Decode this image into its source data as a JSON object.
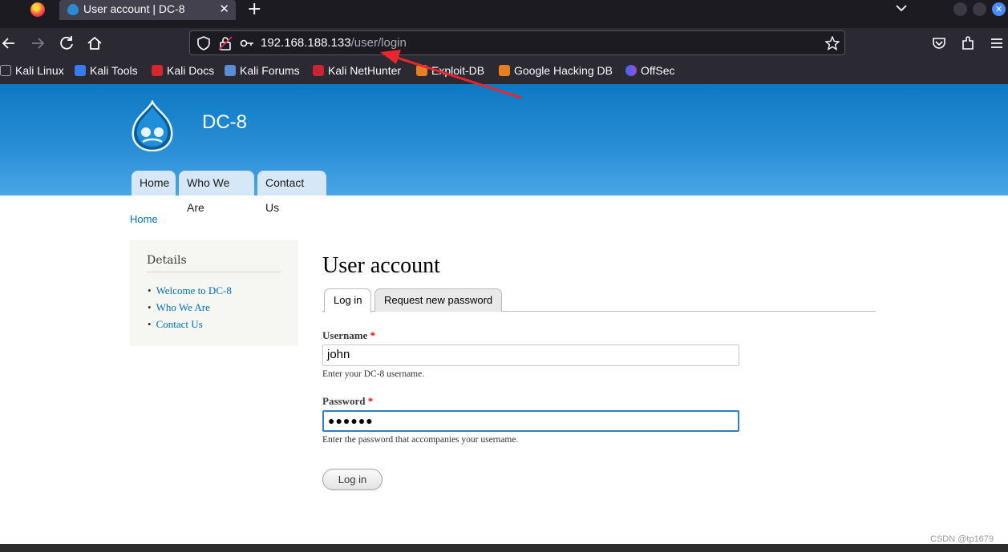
{
  "browser": {
    "tab_title": "User account | DC-8",
    "tab_close": "✕",
    "new_tab": "+",
    "url_host": "192.168.188.133",
    "url_path": "/user/login",
    "bookmarks": [
      "Kali Linux",
      "Kali Tools",
      "Kali Docs",
      "Kali Forums",
      "Kali NetHunter",
      "Exploit-DB",
      "Google Hacking DB",
      "OffSec"
    ],
    "accent": "#4a8bff"
  },
  "site": {
    "name": "DC-8",
    "nav": [
      "Home",
      "Who We Are",
      "Contact Us"
    ],
    "header_color": "#1a85cf"
  },
  "breadcrumb": "Home",
  "sidebar": {
    "title": "Details",
    "items": [
      "Welcome to DC-8",
      "Who We Are",
      "Contact Us"
    ]
  },
  "main": {
    "title": "User account",
    "tabs": [
      "Log in",
      "Request new password"
    ],
    "username_label": "Username",
    "username_value": "john",
    "username_help": "Enter your DC-8 username.",
    "password_label": "Password",
    "password_value": "●●●●●●",
    "password_help": "Enter the password that accompanies your username.",
    "required_mark": "*",
    "submit": "Log in"
  },
  "watermark": "CSDN @tp1679"
}
